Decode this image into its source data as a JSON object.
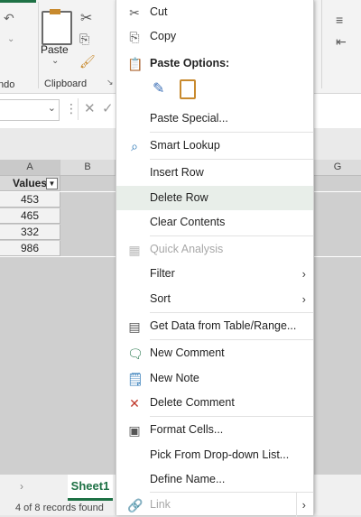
{
  "ribbon": {
    "undo_group_label": "ndo",
    "paste_label": "Paste",
    "clipboard_group_label": "Clipboard"
  },
  "sheet": {
    "columns": [
      "A",
      "B",
      "G"
    ],
    "header_cell": "Values",
    "values": [
      "453",
      "465",
      "332",
      "986"
    ],
    "tab_name": "Sheet1",
    "status_text": "4 of 8 records found"
  },
  "menu": {
    "cut": "Cut",
    "copy": "Copy",
    "paste_options": "Paste Options:",
    "paste_special": "Paste Special...",
    "smart_lookup": "Smart Lookup",
    "insert_row": "Insert Row",
    "delete_row": "Delete Row",
    "clear_contents": "Clear Contents",
    "quick_analysis": "Quick Analysis",
    "filter": "Filter",
    "sort": "Sort",
    "get_data": "Get Data from Table/Range...",
    "new_comment": "New Comment",
    "new_note": "New Note",
    "delete_comment": "Delete Comment",
    "format_cells": "Format Cells...",
    "pick_list": "Pick From Drop-down List...",
    "define_name": "Define Name...",
    "link": "Link"
  },
  "colors": {
    "accent": "#1e7145",
    "hover": "#e8eee9"
  }
}
